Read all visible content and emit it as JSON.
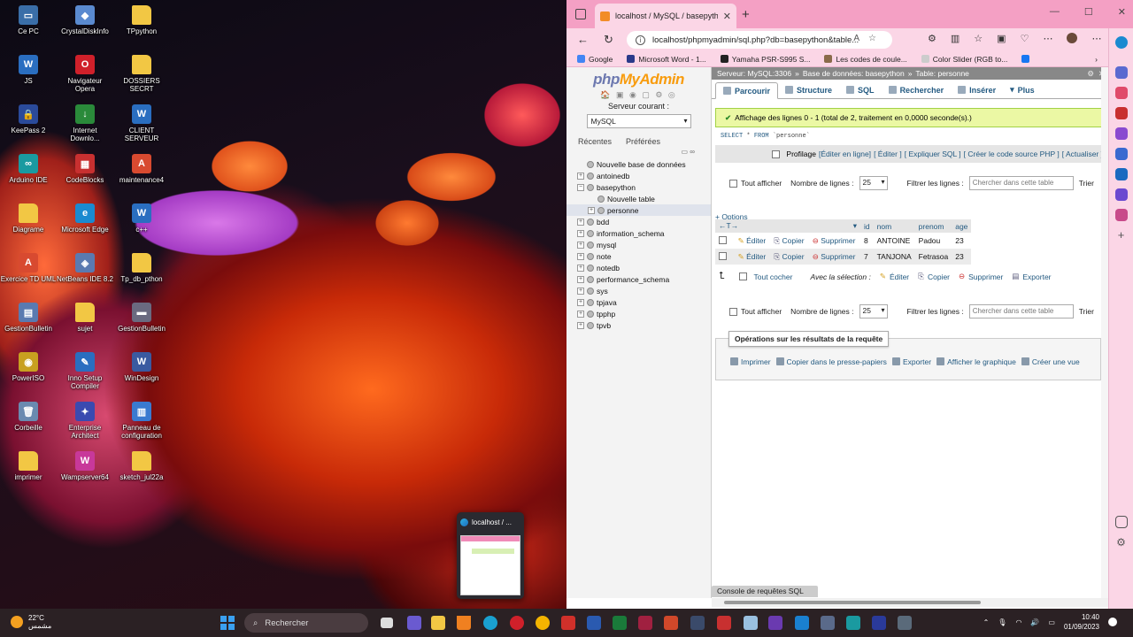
{
  "desktop": {
    "icons": [
      {
        "label": "Ce PC",
        "color": "#3a6ea8",
        "glyph": "▭"
      },
      {
        "label": "CrystalDiskInfo",
        "color": "#5a8ad0",
        "glyph": "◆"
      },
      {
        "label": "TPpython",
        "color": "#f2c744",
        "glyph": ""
      },
      {
        "label": "JS",
        "color": "#2a6ec0",
        "glyph": "W"
      },
      {
        "label": "Navigateur\nOpera",
        "color": "#d0202a",
        "glyph": "O"
      },
      {
        "label": "DOSSIERS SECRT",
        "color": "#f2c744",
        "glyph": ""
      },
      {
        "label": "KeePass 2",
        "color": "#2a4a9a",
        "glyph": "🔒"
      },
      {
        "label": "Internet\nDownlo...",
        "color": "#2a8a3a",
        "glyph": "↓"
      },
      {
        "label": "CLIENT SERVEUR",
        "color": "#2a6ec0",
        "glyph": "W"
      },
      {
        "label": "Arduino IDE",
        "color": "#1a9aa0",
        "glyph": "∞"
      },
      {
        "label": "CodeBlocks",
        "color": "#c83030",
        "glyph": "▦"
      },
      {
        "label": "maintenance4",
        "color": "#d84a30",
        "glyph": "A"
      },
      {
        "label": "Diagrame",
        "color": "#f2c744",
        "glyph": ""
      },
      {
        "label": "Microsoft Edge",
        "color": "#1a8ad0",
        "glyph": "e"
      },
      {
        "label": "c++",
        "color": "#2a6ec0",
        "glyph": "W"
      },
      {
        "label": "Exercice TD UML",
        "color": "#d84a30",
        "glyph": "A"
      },
      {
        "label": "NetBeans IDE 8.2",
        "color": "#5a7ab0",
        "glyph": "◈"
      },
      {
        "label": "Tp_db_pthon",
        "color": "#f2c744",
        "glyph": ""
      },
      {
        "label": "GestionBulletin",
        "color": "#5a7ab0",
        "glyph": "▤"
      },
      {
        "label": "sujet",
        "color": "#f2c744",
        "glyph": ""
      },
      {
        "label": "GestionBulletin",
        "color": "#6a6a80",
        "glyph": "▬"
      },
      {
        "label": "PowerISO",
        "color": "#c8a020",
        "glyph": "◉"
      },
      {
        "label": "Inno Setup\nCompiler",
        "color": "#2a6ec0",
        "glyph": "✎"
      },
      {
        "label": "WinDesign",
        "color": "#3a5aa0",
        "glyph": "W"
      },
      {
        "label": "Corbeille",
        "color": "#6a8ab0",
        "glyph": "🗑"
      },
      {
        "label": "Enterprise\nArchitect",
        "color": "#3a4ab0",
        "glyph": "✦"
      },
      {
        "label": "Panneau de\nconfiguration",
        "color": "#3a7ad0",
        "glyph": "▥"
      },
      {
        "label": "imprimer",
        "color": "#f2c744",
        "glyph": ""
      },
      {
        "label": "Wampserver64",
        "color": "#c8389a",
        "glyph": "W"
      },
      {
        "label": "sketch_jul22a",
        "color": "#f2c744",
        "glyph": ""
      }
    ],
    "thumb_label": "localhost / ..."
  },
  "browser": {
    "tab_title": "localhost / MySQL / basepython",
    "tab_close": "✕",
    "newtab": "+",
    "win": [
      "—",
      "☐",
      "✕"
    ],
    "url": "localhost/phpmyadmin/sql.php?db=basepython&table...",
    "bookmarks": [
      {
        "label": "Google",
        "color": "#4285f4"
      },
      {
        "label": "Microsoft Word - 1...",
        "color": "#2a3a8a"
      },
      {
        "label": "Yamaha PSR-S995 S...",
        "color": "#222"
      },
      {
        "label": "Les codes de coule...",
        "color": "#8a6a4a"
      },
      {
        "label": "Color Slider (RGB to...",
        "color": "#ccc"
      },
      {
        "label": "",
        "color": "#1877f2"
      }
    ]
  },
  "pma": {
    "logo_php": "php",
    "logo_myadmin": "MyAdmin",
    "logo_icons": "🏠 ▣ ◉ ▢ ⚙ ◎",
    "server_label": "Serveur courant :",
    "server_value": "MySQL",
    "left_tabs": [
      "Récentes",
      "Préférées"
    ],
    "left_ctl": "▭ ∞",
    "tree": [
      {
        "label": "Nouvelle base de données",
        "level": 0,
        "pm": ""
      },
      {
        "label": "antoinedb",
        "level": 0,
        "pm": "+"
      },
      {
        "label": "basepython",
        "level": 0,
        "pm": "−"
      },
      {
        "label": "Nouvelle table",
        "level": 1,
        "pm": ""
      },
      {
        "label": "personne",
        "level": 1,
        "pm": "+"
      },
      {
        "label": "bdd",
        "level": 0,
        "pm": "+"
      },
      {
        "label": "information_schema",
        "level": 0,
        "pm": "+"
      },
      {
        "label": "mysql",
        "level": 0,
        "pm": "+"
      },
      {
        "label": "note",
        "level": 0,
        "pm": "+"
      },
      {
        "label": "notedb",
        "level": 0,
        "pm": "+"
      },
      {
        "label": "performance_schema",
        "level": 0,
        "pm": "+"
      },
      {
        "label": "sys",
        "level": 0,
        "pm": "+"
      },
      {
        "label": "tpjava",
        "level": 0,
        "pm": "+"
      },
      {
        "label": "tpphp",
        "level": 0,
        "pm": "+"
      },
      {
        "label": "tpvb",
        "level": 0,
        "pm": "+"
      }
    ],
    "crumb": [
      "Serveur: MySQL:3306",
      "»",
      "Base de données: basepython",
      "»",
      "Table: personne"
    ],
    "crumb_gear": "⚙",
    "crumb_x": "✕",
    "tabs": [
      "Parcourir",
      "Structure",
      "SQL",
      "Rechercher",
      "Insérer",
      "Plus"
    ],
    "success": "Affichage des lignes 0 - 1 (total de 2, traitement en 0,0000 seconde(s).)",
    "sql_select": "SELECT",
    "sql_star": "*",
    "sql_from": "FROM",
    "sql_table": "`personne`",
    "profil_label": "Profilage",
    "profil_links": [
      "[Éditer en ligne]",
      "[ Éditer ]",
      "[ Expliquer SQL ]",
      "[ Créer le code source PHP ]",
      "[ Actualiser ]"
    ],
    "show_all": "Tout afficher",
    "rows_label": "Nombre de lignes :",
    "rows_value": "25",
    "filter_label": "Filtrer les lignes :",
    "filter_placeholder": "Chercher dans cette table",
    "sort_label": "Trier",
    "options": "+ Options",
    "columns": [
      "id",
      "nom",
      "prenom",
      "age"
    ],
    "rows": [
      {
        "id": "8",
        "nom": "ANTOINE",
        "prenom": "Padou",
        "age": "23"
      },
      {
        "id": "7",
        "nom": "TANJONA",
        "prenom": "Fetrasoa",
        "age": "23"
      }
    ],
    "edit": "Éditer",
    "copy": "Copier",
    "delete": "Supprimer",
    "check_all": "Tout cocher",
    "with_sel": "Avec la sélection :",
    "sel_edit": "Éditer",
    "sel_copy": "Copier",
    "sel_delete": "Supprimer",
    "sel_export": "Exporter",
    "ops_title": "Opérations sur les résultats de la requête",
    "ops": [
      "Imprimer",
      "Copier dans le presse-papiers",
      "Exporter",
      "Afficher le graphique",
      "Créer une vue"
    ],
    "console": "Console de requêtes SQL"
  },
  "taskbar": {
    "temp": "22°C",
    "weather_sub": "مشمس",
    "search": "Rechercher",
    "time": "10:40",
    "date": "01/09/2023"
  }
}
